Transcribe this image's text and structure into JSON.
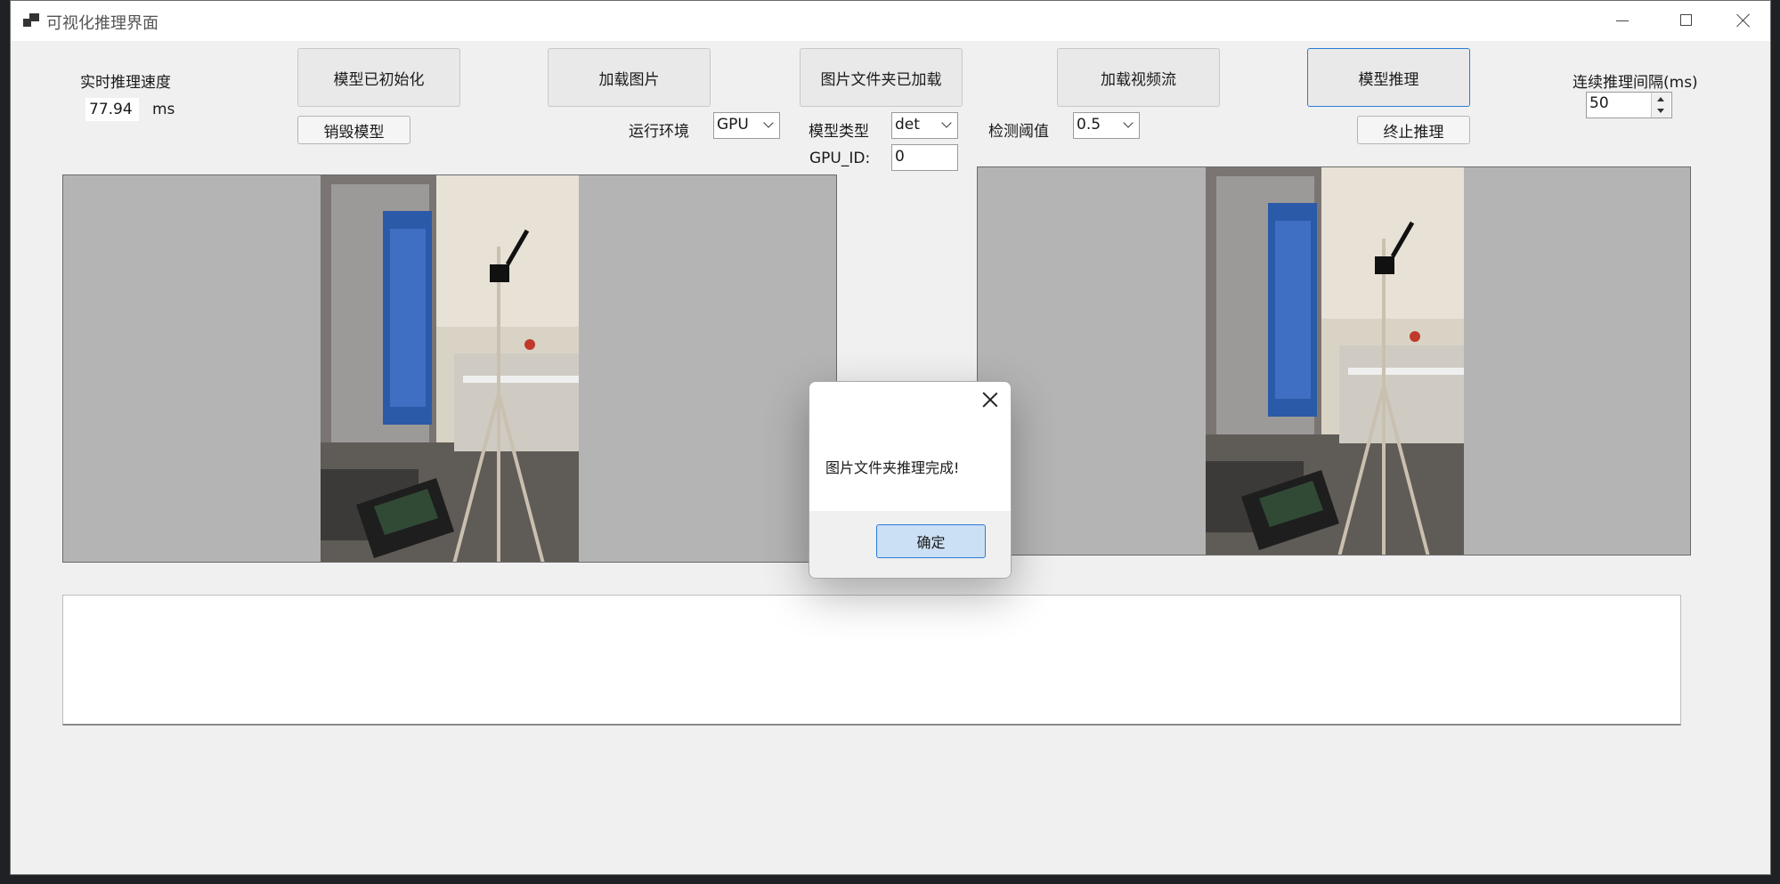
{
  "window": {
    "title": "可视化推理界面"
  },
  "speed": {
    "label": "实时推理速度",
    "value": "77.94",
    "unit": "ms"
  },
  "buttons": {
    "init_model": "模型已初始化",
    "destroy_model": "销毁模型",
    "load_image": "加载图片",
    "image_folder": "图片文件夹已加载",
    "load_video": "加载视频流",
    "infer": "模型推理",
    "stop_infer": "终止推理"
  },
  "env": {
    "label": "运行环境",
    "value": "GPU"
  },
  "model_type": {
    "label": "模型类型",
    "value": "det"
  },
  "gpu": {
    "label": "GPU_ID:",
    "value": "0"
  },
  "threshold": {
    "label": "检测阈值",
    "value": "0.5"
  },
  "interval": {
    "label": "连续推理间隔(ms)",
    "value": "50"
  },
  "dialog": {
    "message": "图片文件夹推理完成!",
    "ok": "确定"
  },
  "icons": [
    "app-icon",
    "minimize-icon",
    "maximize-icon",
    "close-icon",
    "chevron-down-icon",
    "spin-up-icon",
    "spin-down-icon"
  ]
}
